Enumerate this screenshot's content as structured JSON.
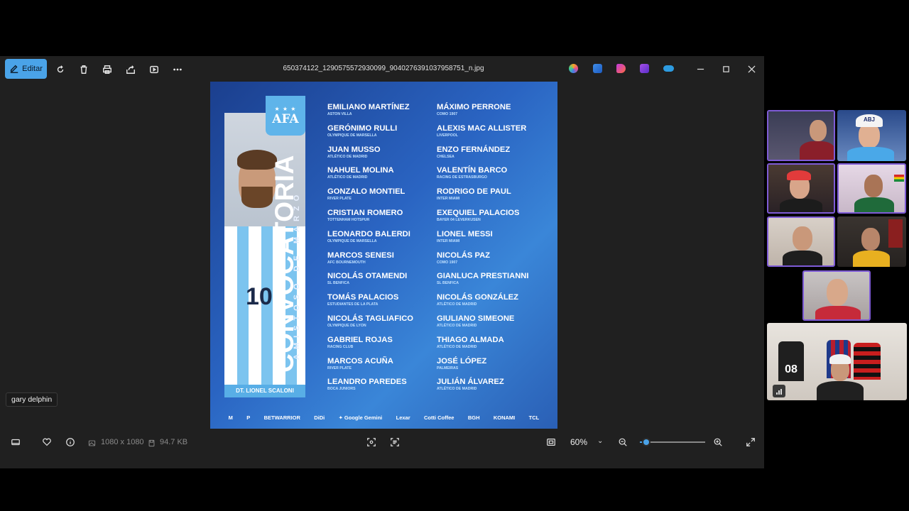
{
  "toolbar": {
    "edit_label": "Editar",
    "filename": "650374122_1290575572930099_9040276391037958751_n.jpg",
    "icons": [
      "rotate-icon",
      "delete-icon",
      "print-icon",
      "share-icon",
      "slideshow-icon",
      "more-icon"
    ],
    "app_icons": [
      "copilot-icon",
      "designer-icon",
      "clipchamp-icon",
      "photos-icon",
      "onedrive-icon"
    ]
  },
  "poster": {
    "badge_stars": "★ ★ ★",
    "badge_text": "AFA",
    "title": "CONVOCATORIA",
    "subtitle": "AMISTOSO DE MARZO",
    "coach": "DT. LIONEL SCALONI",
    "jersey_number": "10",
    "players_left": [
      {
        "name": "EMILIANO MARTÍNEZ",
        "club": "ASTON VILLA"
      },
      {
        "name": "GERÓNIMO RULLI",
        "club": "OLYMPIQUE DE MARSELLA"
      },
      {
        "name": "JUAN MUSSO",
        "club": "ATLÉTICO DE MADRID"
      },
      {
        "name": "NAHUEL MOLINA",
        "club": "ATLÉTICO DE MADRID"
      },
      {
        "name": "GONZALO MONTIEL",
        "club": "RIVER PLATE"
      },
      {
        "name": "CRISTIAN ROMERO",
        "club": "TOTTENHAM HOTSPUR"
      },
      {
        "name": "LEONARDO BALERDI",
        "club": "OLYMPIQUE DE MARSELLA"
      },
      {
        "name": "MARCOS SENESI",
        "club": "AFC BOURNEMOUTH"
      },
      {
        "name": "NICOLÁS OTAMENDI",
        "club": "SL BENFICA"
      },
      {
        "name": "TOMÁS PALACIOS",
        "club": "ESTUDIANTES DE LA PLATA"
      },
      {
        "name": "NICOLÁS TAGLIAFICO",
        "club": "OLYMPIQUE DE LYON"
      },
      {
        "name": "GABRIEL ROJAS",
        "club": "RACING CLUB"
      },
      {
        "name": "MARCOS ACUÑA",
        "club": "RIVER PLATE"
      },
      {
        "name": "LEANDRO PAREDES",
        "club": "BOCA JUNIORS"
      }
    ],
    "players_right": [
      {
        "name": "MÁXIMO PERRONE",
        "club": "COMO 1907"
      },
      {
        "name": "ALEXIS MAC ALLISTER",
        "club": "LIVERPOOL"
      },
      {
        "name": "ENZO FERNÁNDEZ",
        "club": "CHELSEA"
      },
      {
        "name": "VALENTÍN BARCO",
        "club": "RACING DE ESTRASBURGO"
      },
      {
        "name": "RODRIGO DE PAUL",
        "club": "INTER MIAMI"
      },
      {
        "name": "EXEQUIEL PALACIOS",
        "club": "BAYER 04 LEVERKUSEN"
      },
      {
        "name": "LIONEL MESSI",
        "club": "INTER MIAMI"
      },
      {
        "name": "NICOLÁS PAZ",
        "club": "COMO 1907"
      },
      {
        "name": "GIANLUCA PRESTIANNI",
        "club": "SL BENFICA"
      },
      {
        "name": "NICOLÁS GONZÁLEZ",
        "club": "ATLÉTICO DE MADRID"
      },
      {
        "name": "GIULIANO SIMEONE",
        "club": "ATLÉTICO DE MADRID"
      },
      {
        "name": "THIAGO ALMADA",
        "club": "ATLÉTICO DE MADRID"
      },
      {
        "name": "JOSÉ LÓPEZ",
        "club": "PALMEIRAS"
      },
      {
        "name": "JULIÁN ÁLVAREZ",
        "club": "ATLÉTICO DE MADRID"
      }
    ],
    "sponsors": [
      "M",
      "P",
      "BETWARRIOR",
      "DiDi",
      "✦ Google Gemini",
      "Lexar",
      "Cotti Coffee",
      "BGH",
      "KONAMI",
      "TCL"
    ]
  },
  "bottombar": {
    "dimensions": "1080 x 1080",
    "file_size": "94.7 KB",
    "zoom_value": "60%",
    "zoom_fraction": 0.1,
    "tooltip": "gary delphin"
  },
  "call": {
    "participants": 8,
    "accent_color": "#7e5bd6",
    "tile_cap_text": "ABJ",
    "jersey_number": "08"
  }
}
